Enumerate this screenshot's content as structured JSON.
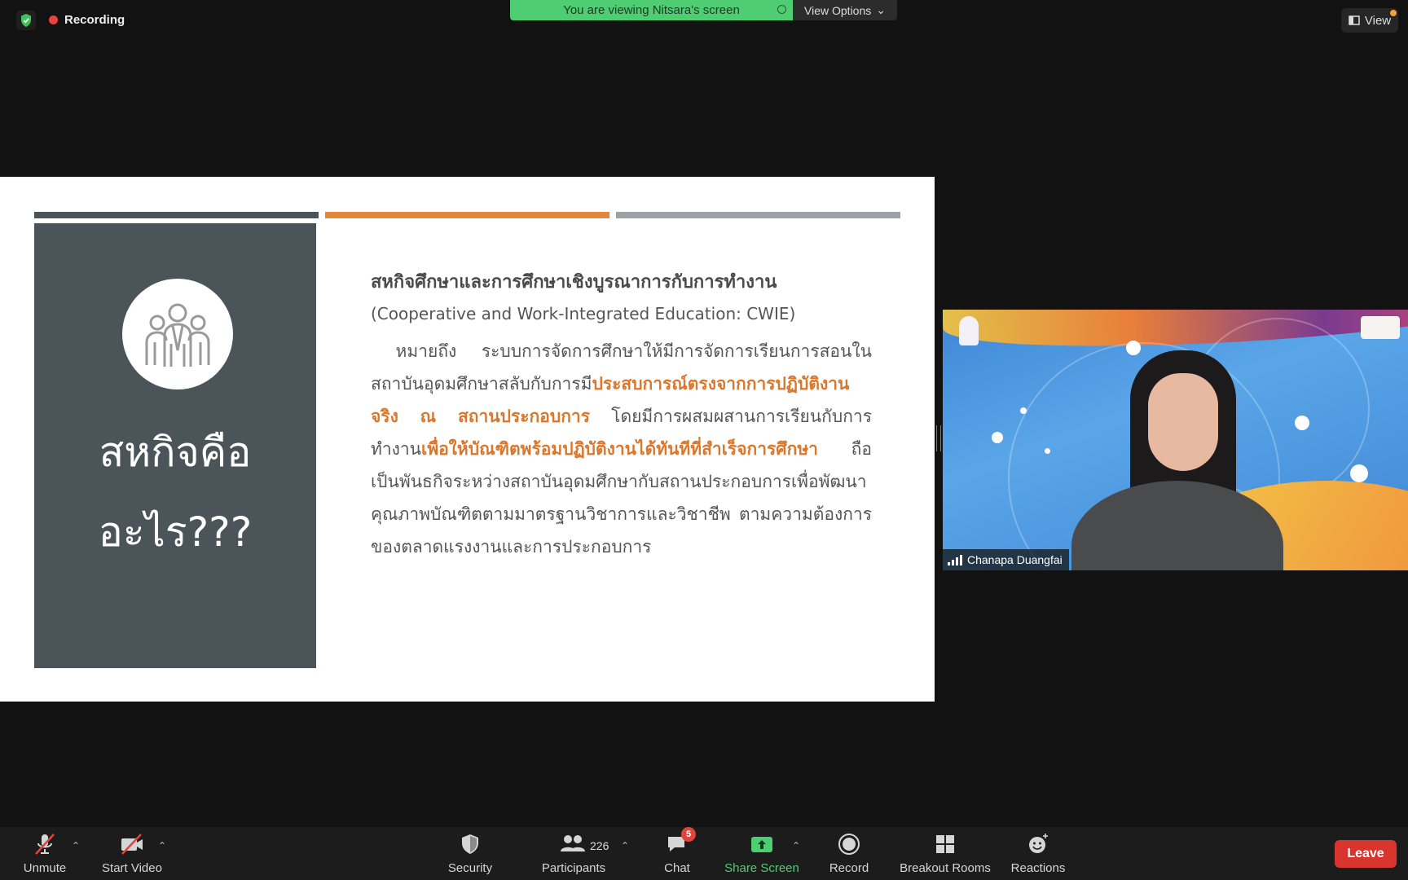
{
  "top_bar": {
    "recording_label": "Recording",
    "viewing_banner": "You are viewing Nitsara's screen",
    "view_options_label": "View Options",
    "view_label": "View"
  },
  "slide": {
    "panel_title_line1": "สหกิจคือ",
    "panel_title_line2": "อะไร???",
    "heading": "สหกิจศึกษาและการศึกษาเชิงบูรณาการกับการทำงาน",
    "subheading": "(Cooperative and Work-Integrated Education: CWIE)",
    "body_1": "หมายถึง ระบบการจัดการศึกษาให้มีการจัดการเรียนการสอนในสถาบันอุดมศึกษาสลับกับการมี",
    "highlight_1": "ประสบการณ์ตรงจากการปฏิบัติงานจริง ณ สถานประกอบการ",
    "body_2": " โดยมีการผสมผสานการเรียนกับการทำงาน",
    "highlight_2": "เพื่อให้บัณฑิตพร้อมปฏิบัติงานได้ทันทีที่สำเร็จการศึกษา",
    "body_3": " ถือเป็นพันธกิจระหว่างสถาบันอุดมศึกษากับสถานประกอบการเพื่อพัฒนาคุณภาพบัณฑิตตามมาตรฐานวิชาการและวิชาชีพ ตามความต้องการของตลาดแรงงานและการประกอบการ",
    "colors": {
      "accent": "#e5873e",
      "panel": "#4b5459",
      "strip_gray": "#9fa1a5"
    }
  },
  "video": {
    "participant_name": "Chanapa Duangfai"
  },
  "toolbar": {
    "unmute_label": "Unmute",
    "start_video_label": "Start Video",
    "security_label": "Security",
    "participants_label": "Participants",
    "participants_count": "226",
    "chat_label": "Chat",
    "chat_badge": "5",
    "share_screen_label": "Share Screen",
    "record_label": "Record",
    "breakout_rooms_label": "Breakout Rooms",
    "reactions_label": "Reactions",
    "leave_label": "Leave"
  }
}
